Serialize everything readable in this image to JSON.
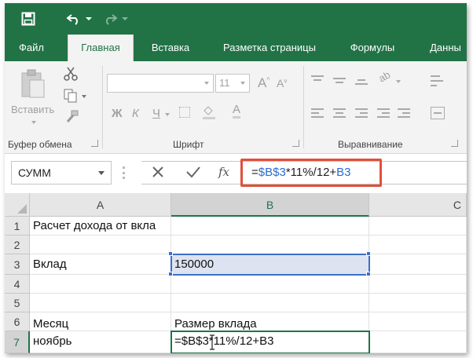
{
  "qat": {
    "save_icon": "save-icon",
    "undo_icon": "undo-icon",
    "redo_icon": "redo-icon"
  },
  "tabs": [
    {
      "label": "Файл",
      "active": false
    },
    {
      "label": "Главная",
      "active": true
    },
    {
      "label": "Вставка",
      "active": false
    },
    {
      "label": "Разметка страницы",
      "active": false
    },
    {
      "label": "Формулы",
      "active": false
    },
    {
      "label": "Данны",
      "active": false
    }
  ],
  "ribbon": {
    "clipboard": {
      "paste_label": "Вставить",
      "group_label": "Буфер обмена"
    },
    "font": {
      "font_size": "11",
      "bold": "Ж",
      "italic": "К",
      "underline": "Ч",
      "group_label": "Шрифт"
    },
    "alignment": {
      "group_label": "Выравнивание"
    }
  },
  "formula_bar": {
    "name_box": "СУММ",
    "fx_label": "fx",
    "formula": {
      "eq": "=",
      "ref1": "$B$3",
      "middle": "*11%/12+",
      "ref2": "B3"
    }
  },
  "grid": {
    "columns": [
      "A",
      "B",
      "C"
    ],
    "rows": [
      "1",
      "2",
      "3",
      "4",
      "5",
      "6",
      "7"
    ],
    "cells": {
      "A1": "Расчет дохода от вкла",
      "A3": "Вклад",
      "B3": "150000",
      "A6": "Месяц",
      "B6": "Размер вклада",
      "A7": "ноябрь",
      "B7": "=$B$3*11%/12+B3"
    }
  },
  "colors": {
    "accent": "#217346",
    "highlight": "#e0503a",
    "reference": "#2a6bd1"
  }
}
